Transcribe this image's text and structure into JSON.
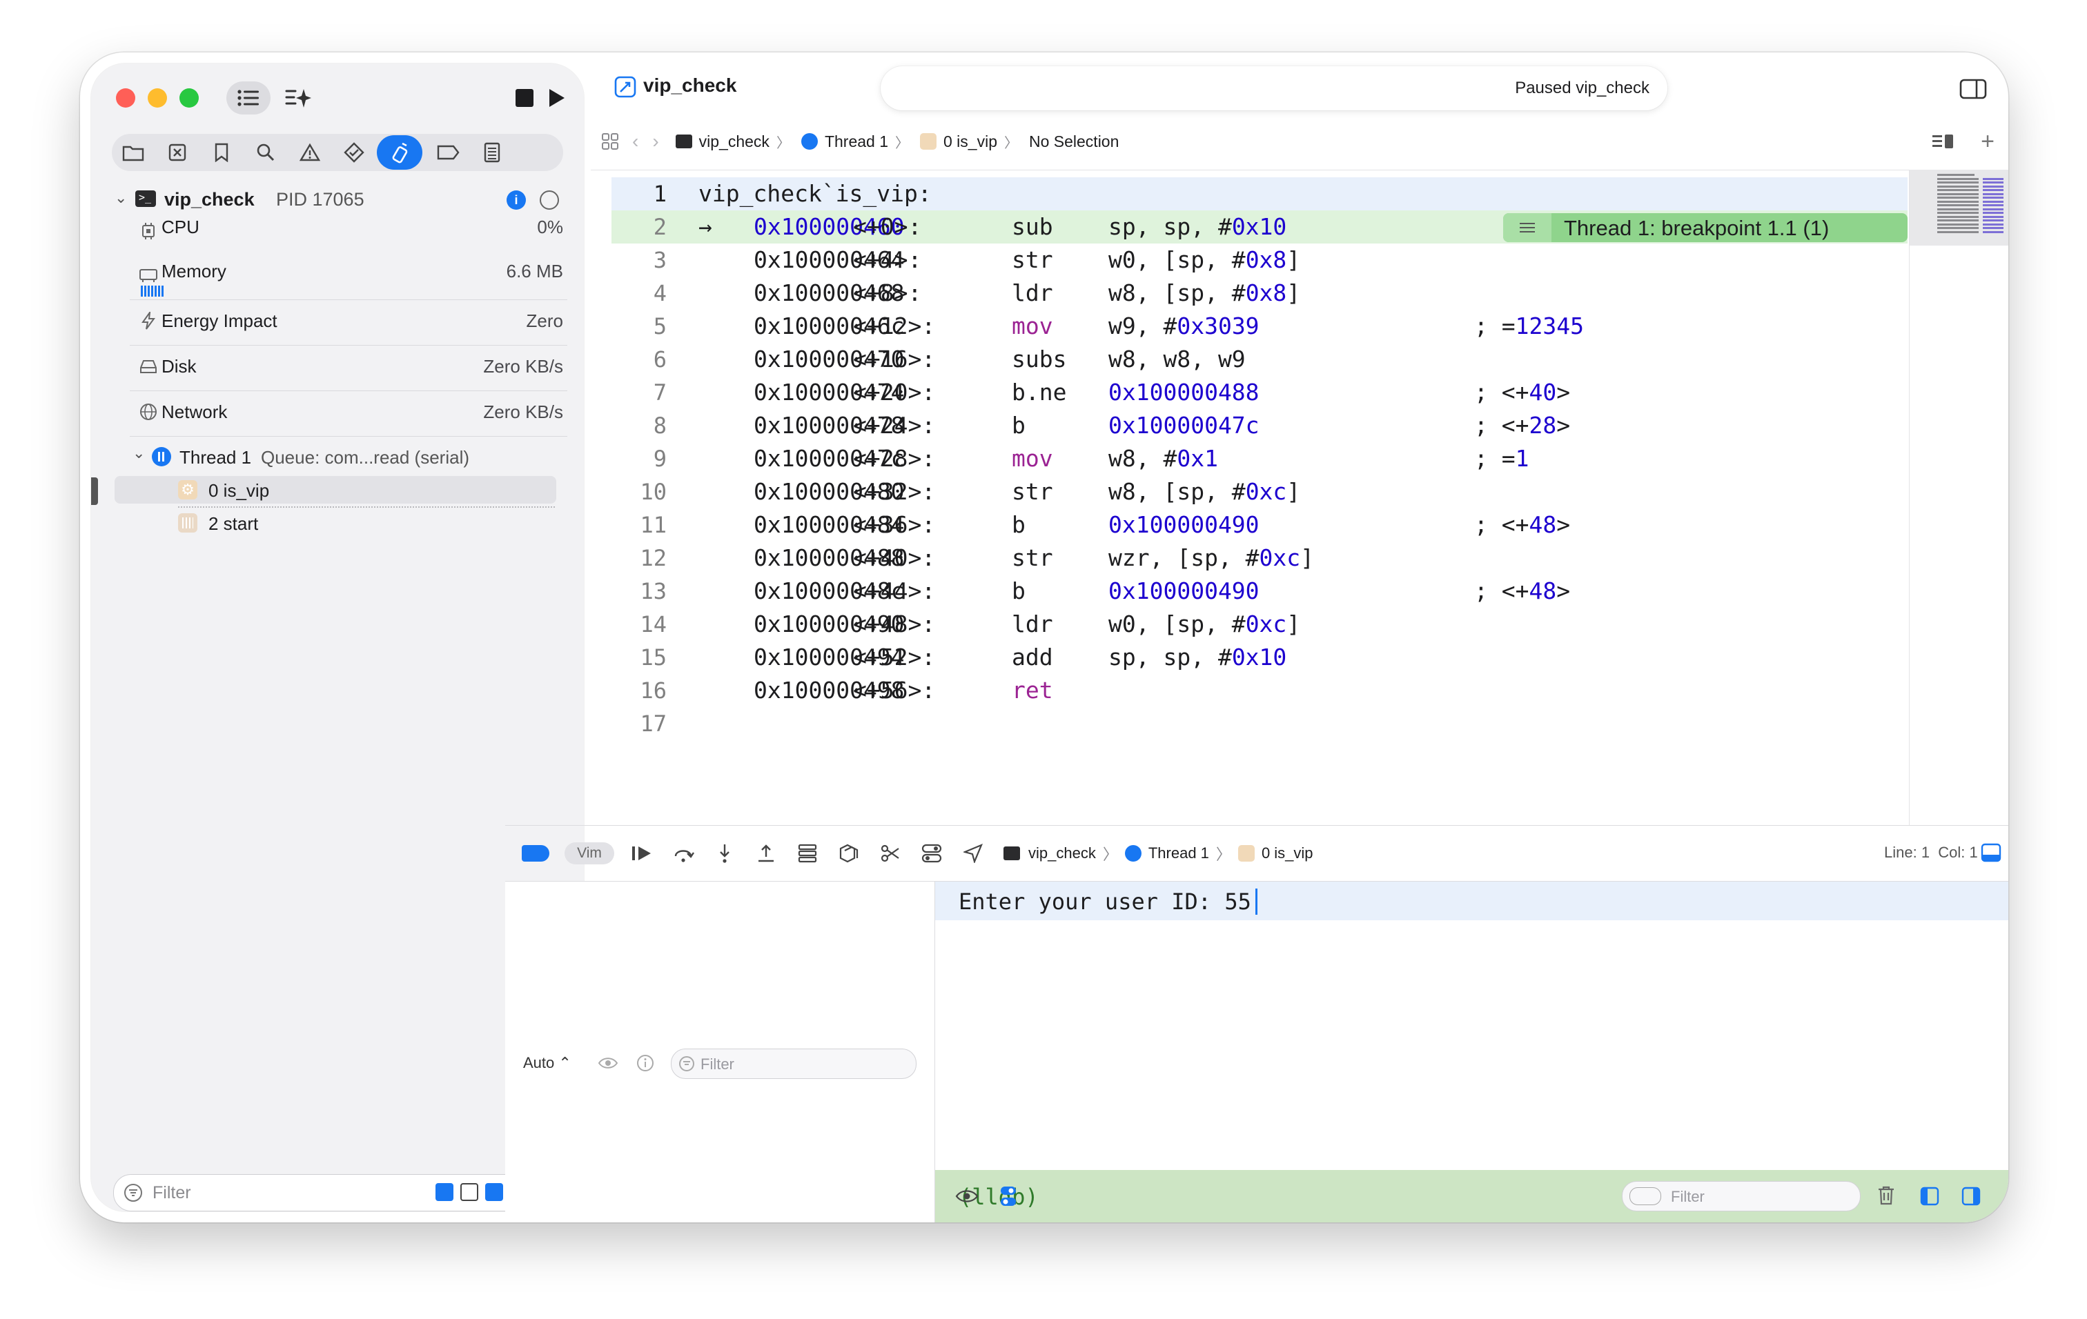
{
  "window": {
    "title": "vip_check",
    "status": "Paused vip_check"
  },
  "sidebar": {
    "process": {
      "name": "vip_check",
      "pid": "PID 17065"
    },
    "gauges": [
      {
        "label": "CPU",
        "value": "0%",
        "icon": "cpu-icon"
      },
      {
        "label": "Memory",
        "value": "6.6 MB",
        "icon": "memory-icon"
      },
      {
        "label": "Energy Impact",
        "value": "Zero",
        "icon": "bolt-icon"
      },
      {
        "label": "Disk",
        "value": "Zero KB/s",
        "icon": "disk-icon"
      },
      {
        "label": "Network",
        "value": "Zero KB/s",
        "icon": "globe-icon"
      }
    ],
    "thread": {
      "name": "Thread 1",
      "queue": "Queue: com...read (serial)"
    },
    "frames": [
      {
        "label": "0 is_vip",
        "selected": true
      },
      {
        "label": "2 start",
        "selected": false
      }
    ],
    "filter_placeholder": "Filter"
  },
  "jumpbar": {
    "crumbs": [
      "vip_check",
      "Thread 1",
      "0 is_vip",
      "No Selection"
    ]
  },
  "editor": {
    "header": "vip_check`is_vip:",
    "breakpoint_label": "Thread 1: breakpoint 1.1 (1)",
    "lines": [
      {
        "n": "1"
      },
      {
        "n": "2",
        "addr": "0x100000460",
        "off": "<+0>:",
        "op": "sub",
        "a1": "sp, sp, #",
        "a1n": "0x10",
        "a2": "",
        "cmt": ""
      },
      {
        "n": "3",
        "addr": "0x100000464",
        "off": "<+4>:",
        "op": "str",
        "a1": "w0, [sp, #",
        "a1n": "0x8",
        "a2": "]",
        "cmt": ""
      },
      {
        "n": "4",
        "addr": "0x100000468",
        "off": "<+8>:",
        "op": "ldr",
        "a1": "w8, [sp, #",
        "a1n": "0x8",
        "a2": "]",
        "cmt": ""
      },
      {
        "n": "5",
        "addr": "0x10000046c",
        "off": "<+12>:",
        "op": "mov",
        "opkw": true,
        "a1": "w9, #",
        "a1n": "0x3039",
        "a2": "",
        "cmt": "; =",
        "cmtn": "12345"
      },
      {
        "n": "6",
        "addr": "0x100000470",
        "off": "<+16>:",
        "op": "subs",
        "a1": "w8, w8, w9",
        "a1n": "",
        "a2": "",
        "cmt": ""
      },
      {
        "n": "7",
        "addr": "0x100000474",
        "off": "<+20>:",
        "op": "b.ne",
        "a1": "",
        "a1n": "0x100000488",
        "a2": "",
        "cmt": "; <+",
        "cmtn": "40",
        "cmtt": ">"
      },
      {
        "n": "8",
        "addr": "0x100000478",
        "off": "<+24>:",
        "op": "b",
        "a1": "",
        "a1n": "0x10000047c",
        "a2": "",
        "cmt": "; <+",
        "cmtn": "28",
        "cmtt": ">"
      },
      {
        "n": "9",
        "addr": "0x10000047c",
        "off": "<+28>:",
        "op": "mov",
        "opkw": true,
        "a1": "w8, #",
        "a1n": "0x1",
        "a2": "",
        "cmt": "; =",
        "cmtn": "1"
      },
      {
        "n": "10",
        "addr": "0x100000480",
        "off": "<+32>:",
        "op": "str",
        "a1": "w8, [sp, #",
        "a1n": "0xc",
        "a2": "]",
        "cmt": ""
      },
      {
        "n": "11",
        "addr": "0x100000484",
        "off": "<+36>:",
        "op": "b",
        "a1": "",
        "a1n": "0x100000490",
        "a2": "",
        "cmt": "; <+",
        "cmtn": "48",
        "cmtt": ">"
      },
      {
        "n": "12",
        "addr": "0x100000488",
        "off": "<+40>:",
        "op": "str",
        "a1": "wzr, [sp, #",
        "a1n": "0xc",
        "a2": "]",
        "cmt": ""
      },
      {
        "n": "13",
        "addr": "0x10000048c",
        "off": "<+44>:",
        "op": "b",
        "a1": "",
        "a1n": "0x100000490",
        "a2": "",
        "cmt": "; <+",
        "cmtn": "48",
        "cmtt": ">"
      },
      {
        "n": "14",
        "addr": "0x100000490",
        "off": "<+48>:",
        "op": "ldr",
        "a1": "w0, [sp, #",
        "a1n": "0xc",
        "a2": "]",
        "cmt": ""
      },
      {
        "n": "15",
        "addr": "0x100000494",
        "off": "<+52>:",
        "op": "add",
        "a1": "sp, sp, #",
        "a1n": "0x10",
        "a2": "",
        "cmt": ""
      },
      {
        "n": "16",
        "addr": "0x100000498",
        "off": "<+56>:",
        "op": "ret",
        "opkw": true,
        "a1": "",
        "a1n": "",
        "a2": "",
        "cmt": ""
      },
      {
        "n": "17"
      }
    ]
  },
  "debugbar": {
    "vim_label": "Vim",
    "crumbs": [
      "vip_check",
      "Thread 1",
      "0 is_vip"
    ],
    "line_col": "Line: 1  Col: 1"
  },
  "variables": {
    "scope": "Auto ⌃",
    "filter_placeholder": "Filter"
  },
  "console": {
    "output": "Enter your user ID: 55",
    "prompt": "(lldb)",
    "filter_placeholder": "Filter"
  },
  "colors": {
    "accent": "#1877f2",
    "breakpoint_green": "#8fd48c",
    "pc_line": "#dff3dc",
    "current_line": "#e8f0fb",
    "lldb_bar": "#cde5c4"
  }
}
